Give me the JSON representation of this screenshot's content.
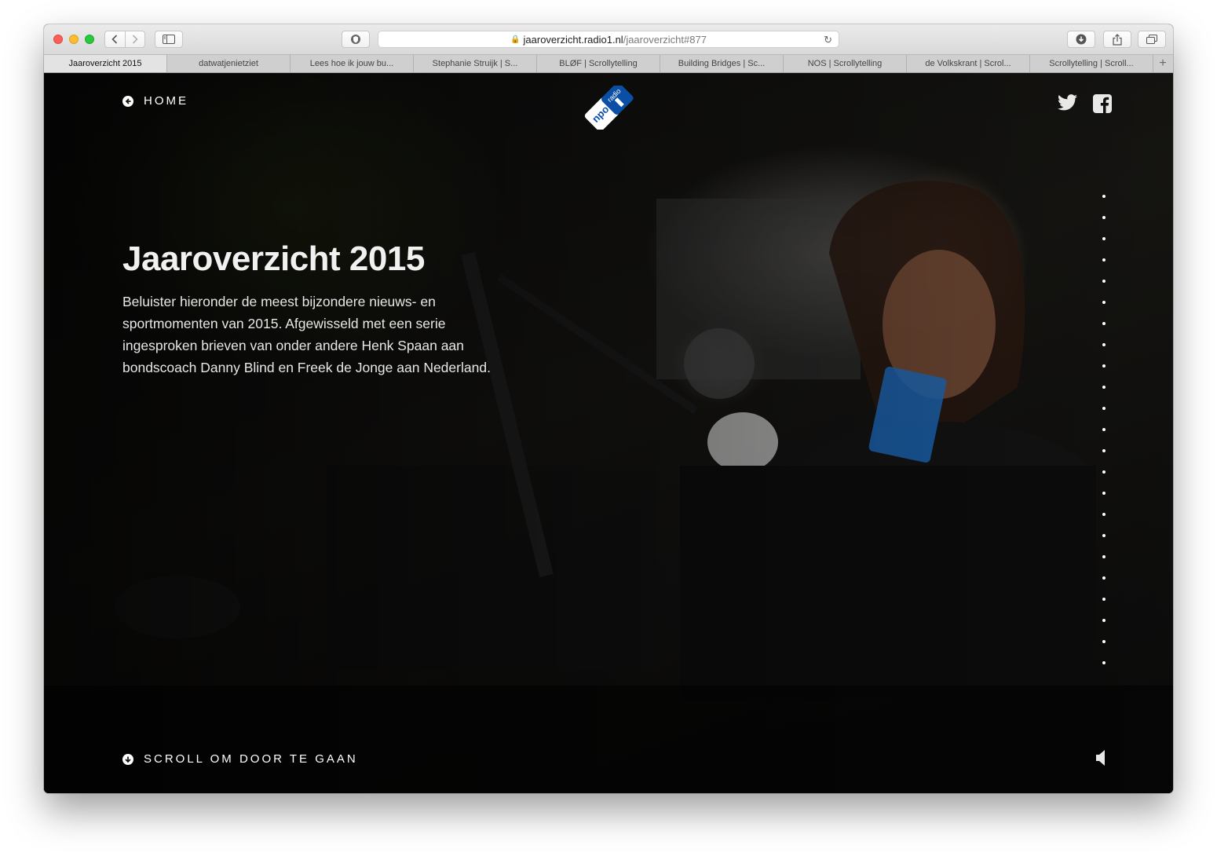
{
  "browser": {
    "url_domain": "jaaroverzicht.radio1.nl",
    "url_path": "/jaaroverzicht#877",
    "tabs": [
      {
        "label": "Jaaroverzicht 2015",
        "active": true
      },
      {
        "label": "datwatjenietziet"
      },
      {
        "label": "Lees hoe ik jouw bu..."
      },
      {
        "label": "Stephanie Struijk | S..."
      },
      {
        "label": "BLØF | Scrollytelling"
      },
      {
        "label": "Building Bridges | Sc..."
      },
      {
        "label": "NOS | Scrollytelling"
      },
      {
        "label": "de Volkskrant | Scrol..."
      },
      {
        "label": "Scrollytelling | Scroll..."
      }
    ],
    "new_tab_symbol": "+"
  },
  "page": {
    "home_label": "HOME",
    "logo": {
      "top_text": "npo",
      "bottom_text": "radio",
      "numeral": "1",
      "color": "#0a4fa5"
    },
    "title": "Jaaroverzicht 2015",
    "description": "Beluister hieronder de meest bijzondere nieuws- en sportmomenten van 2015. Afgewisseld met een serie ingesproken brieven van onder andere Henk Spaan aan bondscoach Danny Blind en Freek de Jonge aan Nederland.",
    "scroll_label": "SCROLL OM DOOR TE GAAN",
    "chapter_dot_count": 23,
    "icons": [
      "arrow-left-circle-icon",
      "twitter-icon",
      "facebook-icon",
      "arrow-down-circle-icon",
      "speaker-icon"
    ]
  }
}
